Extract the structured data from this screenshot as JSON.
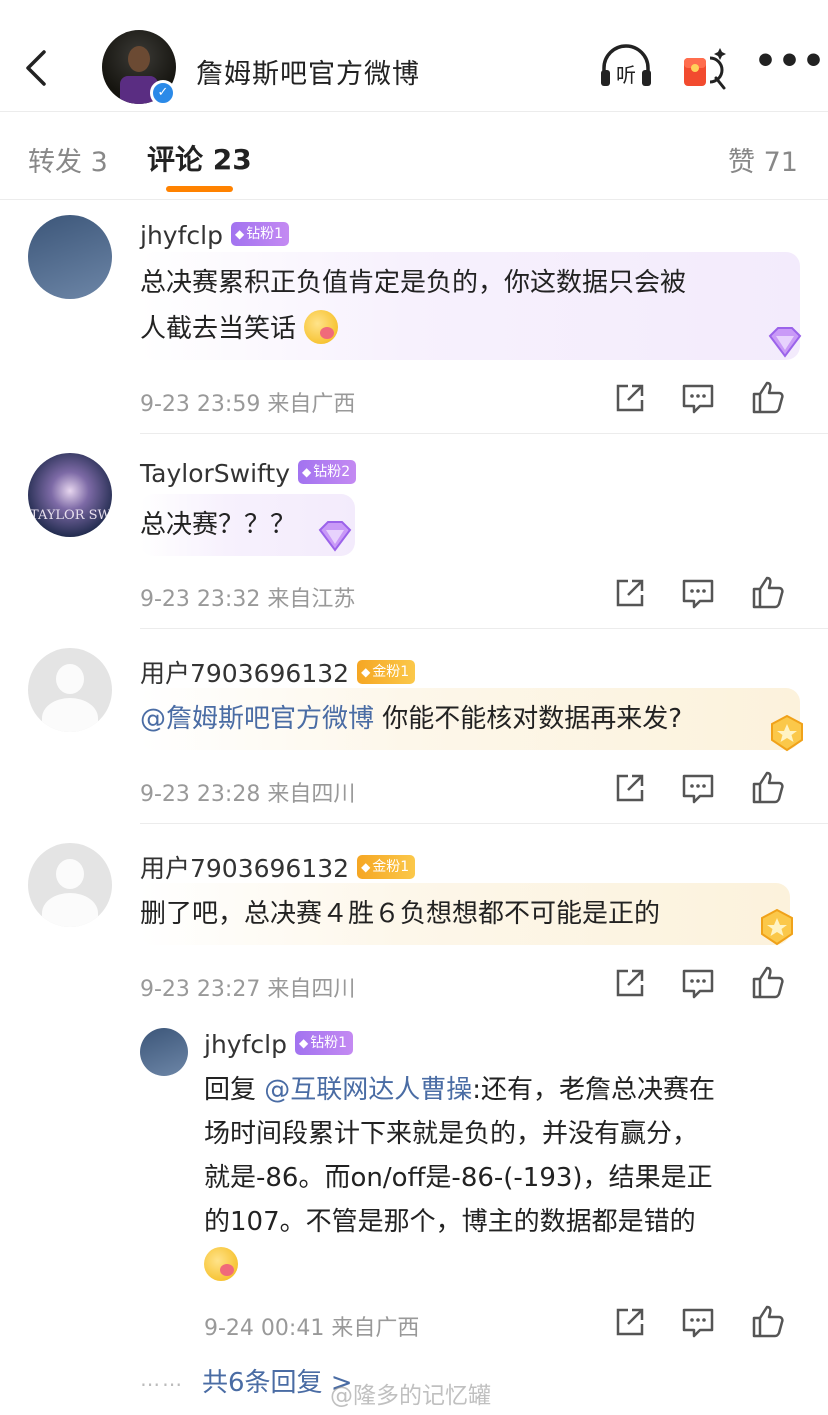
{
  "header": {
    "profile_name": "詹姆斯吧官方微博",
    "verified_mark": "✓",
    "listen_label": "听",
    "more_label": "•••"
  },
  "tabs": {
    "repost": "转发 3",
    "comments": "评论 23",
    "likes": "赞 71"
  },
  "colors": {
    "accent": "#ff8200",
    "link": "#4a6ca4",
    "diamond_badge": "#a273f0",
    "gold_badge": "#f5a623"
  },
  "comments": [
    {
      "username": "jhyfclp",
      "badge": "钻粉1",
      "badge_type": "diamond",
      "text_line1": "总决赛累积正负值肯定是负的，你这数据只会被",
      "text_line2": "人截去当笑话",
      "meta": "9-23 23:59 来自广西"
    },
    {
      "username": "TaylorSwifty",
      "badge": "钻粉2",
      "badge_type": "diamond",
      "avatar_text": "TAYLOR SWIFT",
      "text_line1": "总决赛？？？",
      "meta": "9-23 23:32 来自江苏"
    },
    {
      "username": "用户7903696132",
      "badge": "金粉1",
      "badge_type": "gold",
      "mention": "@詹姆斯吧官方微博",
      "text_line1": " 你能不能核对数据再来发?",
      "meta": "9-23 23:28 来自四川"
    },
    {
      "username": "用户7903696132",
      "badge": "金粉1",
      "badge_type": "gold",
      "text_line1": "删了吧，总决赛４胜６负想想都不可能是正的",
      "meta": "9-23 23:27 来自四川"
    }
  ],
  "reply": {
    "username": "jhyfclp",
    "badge": "钻粉1",
    "prefix": "回复 ",
    "mention": "@互联网达人曹操",
    "line1_rest": ":还有，老詹总决赛在",
    "line2": "场时间段累计下来就是负的，并没有赢分，",
    "line3": "就是-86。而on/off是-86-(-193)，结果是正",
    "line4": "的107。不管是那个，博主的数据都是错的",
    "meta": "9-24 00:41 来自广西"
  },
  "more_replies": {
    "dots": "⋯⋯",
    "label": "共6条回复 >"
  },
  "watermark": "@隆多的记忆罐"
}
